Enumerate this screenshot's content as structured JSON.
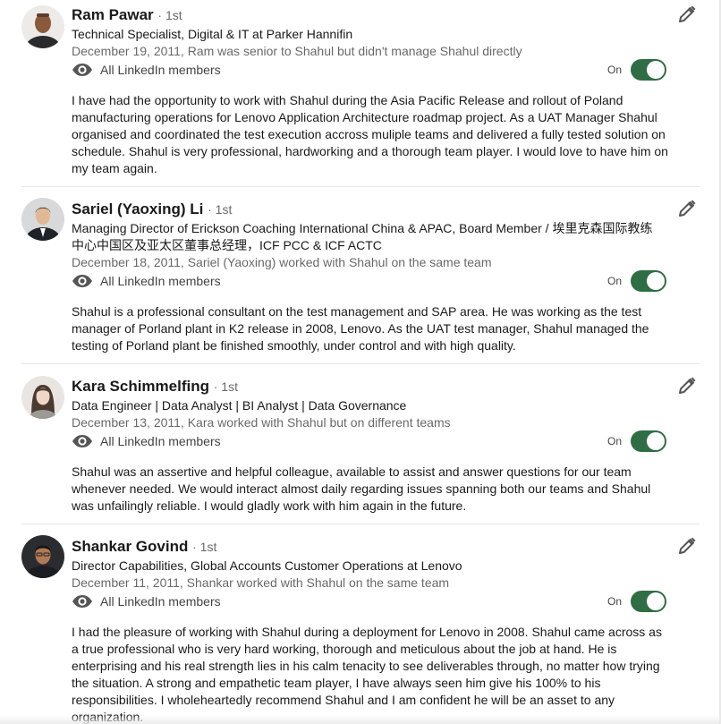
{
  "recommendations": [
    {
      "name": "Ram Pawar",
      "degree": "· 1st",
      "headline": "Technical Specialist, Digital & IT at Parker Hannifin",
      "date": "December 19, 2011, Ram was senior to Shahul but didn't manage Shahul directly",
      "visibility": "All LinkedIn members",
      "toggle_label": "On",
      "text": "I have had the opportunity to work with Shahul during the Asia Pacific Release and rollout of Poland manufacturing operations for Lenovo Application Architecture roadmap project. As a UAT Manager Shahul organised and coordinated the test execution accross muliple teams and delivered a fully tested solution on schedule. Shahul is very professional, hardworking and a thorough team player. I would love to have him on my team again."
    },
    {
      "name": "Sariel (Yaoxing) Li",
      "degree": "· 1st",
      "headline": "Managing Director of Erickson Coaching International China & APAC, Board Member / 埃里克森国际教练中心中国区及亚太区董事总经理，ICF PCC & ICF ACTC",
      "date": "December 18, 2011, Sariel (Yaoxing) worked with Shahul on the same team",
      "visibility": "All LinkedIn members",
      "toggle_label": "On",
      "text": "Shahul is a professional consultant on the test management and SAP area. He was working as the test manager of Porland plant in K2 release in 2008, Lenovo. As the UAT test manager, Shahul managed the testing of Porland plant be finished smoothly, under control and with high quality."
    },
    {
      "name": "Kara Schimmelfing",
      "degree": "· 1st",
      "headline": "Data Engineer | Data Analyst | BI Analyst | Data Governance",
      "date": "December 13, 2011, Kara worked with Shahul but on different teams",
      "visibility": "All LinkedIn members",
      "toggle_label": "On",
      "text": "Shahul was an assertive and helpful colleague, available to assist and answer questions for our team whenever needed. We would interact almost daily regarding issues spanning both our teams and Shahul was unfailingly reliable. I would gladly work with him again in the future."
    },
    {
      "name": "Shankar Govind",
      "degree": "· 1st",
      "headline": "Director Capabilities, Global Accounts Customer Operations at Lenovo",
      "date": "December 11, 2011, Shankar worked with Shahul on the same team",
      "visibility": "All LinkedIn members",
      "toggle_label": "On",
      "text": "I had the pleasure of working with Shahul during a deployment for Lenovo in 2008. Shahul came across as a true professional who is very hard working, thorough and meticulous about the job at hand. He is enterprising and his real strength lies in his calm tenacity to see deliverables through, no matter how trying the situation. A strong and empathetic team player, I have always seen him give his 100% to his responsibilities. I wholeheartedly recommend Shahul and I am confident he will be an asset to any organization."
    }
  ],
  "icons": {
    "edit": "pencil-icon",
    "visibility": "eye-icon"
  },
  "colors": {
    "toggle_on": "#2f6d44",
    "secondary_text": "#666666",
    "divider": "#e6e6e6"
  }
}
